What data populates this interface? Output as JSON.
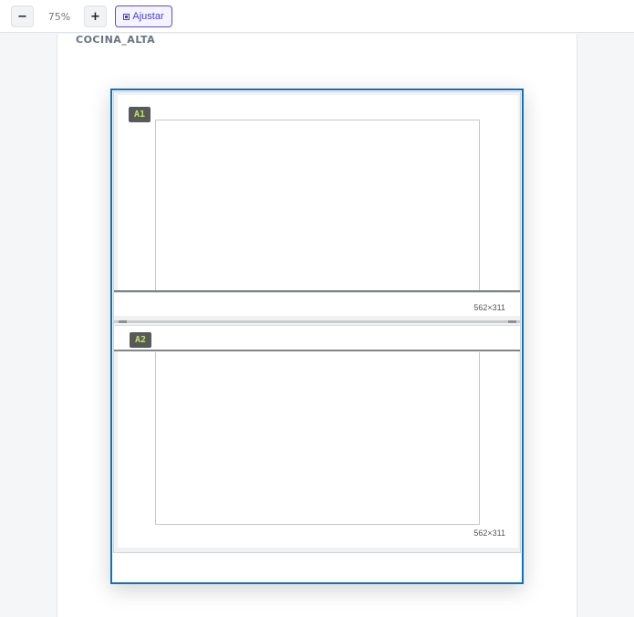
{
  "toolbar": {
    "zoom_out_label": "−",
    "zoom_level": "75%",
    "zoom_in_label": "+",
    "fit_label": "Ajustar",
    "fit_icon": "fit-frame-icon"
  },
  "zone": {
    "title": "COCINA_ALTA"
  },
  "modules": [
    {
      "tag": "A1",
      "dimensions": "562×311"
    },
    {
      "tag": "A2",
      "dimensions": "562×311"
    }
  ],
  "colors": {
    "accent": "#5a4fd1",
    "selection_border": "#1170b8",
    "tag_bg": "#575a58",
    "tag_text": "#c5e16b"
  }
}
